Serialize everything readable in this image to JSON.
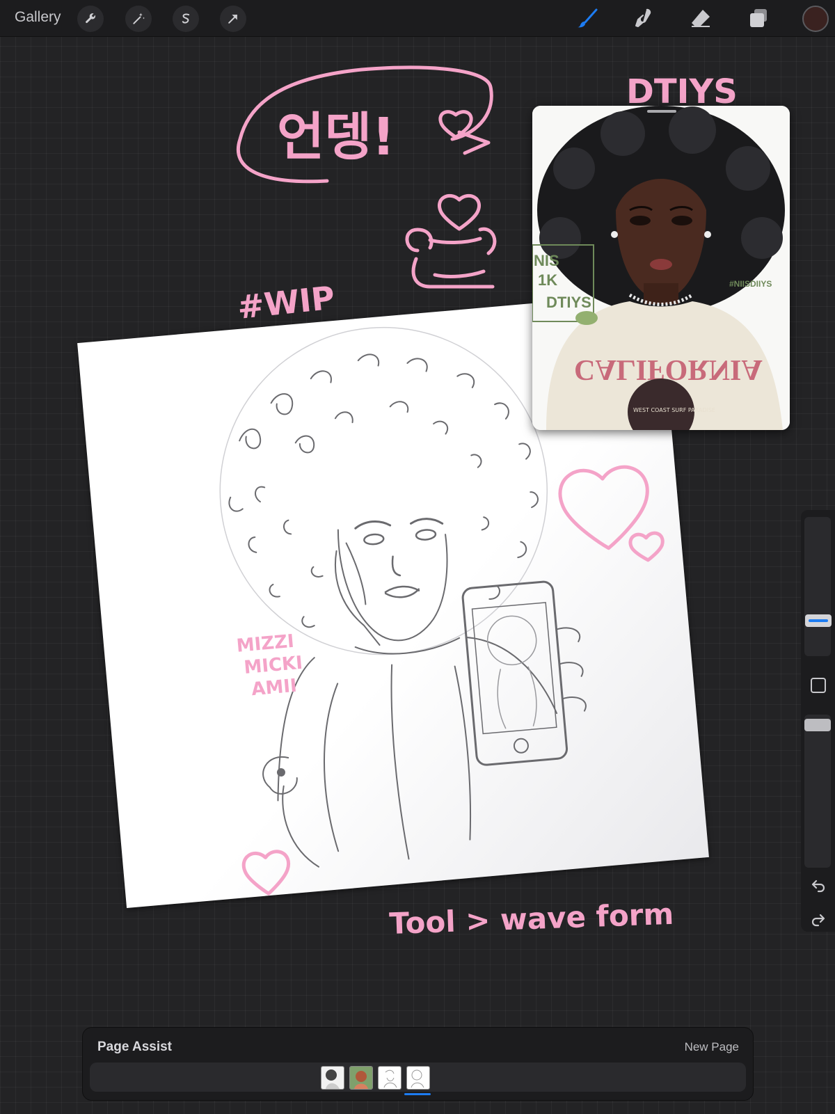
{
  "toolbar": {
    "gallery_label": "Gallery",
    "left_tools": [
      "wrench-icon",
      "magic-wand-icon",
      "selection-icon",
      "transform-arrow-icon"
    ],
    "right_tools": [
      "brush-icon",
      "smudge-icon",
      "eraser-icon",
      "layers-icon"
    ],
    "active_tool": "brush-icon",
    "accent_color": "#1d7cf2",
    "current_color": "#3a2220"
  },
  "canvas": {
    "background_color": "#232325",
    "handwriting": {
      "greeting": "언뎅!",
      "dtiys": "DTIYS",
      "wip": "#WIP",
      "names": [
        "MIZZI",
        "MICKI",
        "AMII"
      ],
      "tool_note": "Tool > wave form"
    },
    "reference_photo": {
      "sign_lines": [
        "NIS",
        "1K",
        "DTIYS"
      ],
      "tag": "#NIISDIIYS",
      "shirt_text": "CALIFORNIA",
      "badge_text": "WEST COAST SURF PARADISE"
    }
  },
  "sidebar": {
    "brush_size_level": 0.75,
    "opacity_level": 0.0
  },
  "page_assist": {
    "title": "Page Assist",
    "new_page_label": "New Page",
    "pages": [
      {
        "name": "page-1",
        "bg": "#f2f2f2"
      },
      {
        "name": "page-2",
        "bg": "#7fa06c"
      },
      {
        "name": "page-3",
        "bg": "#ffffff"
      },
      {
        "name": "page-4",
        "bg": "#ffffff"
      }
    ],
    "active_page": 4
  }
}
